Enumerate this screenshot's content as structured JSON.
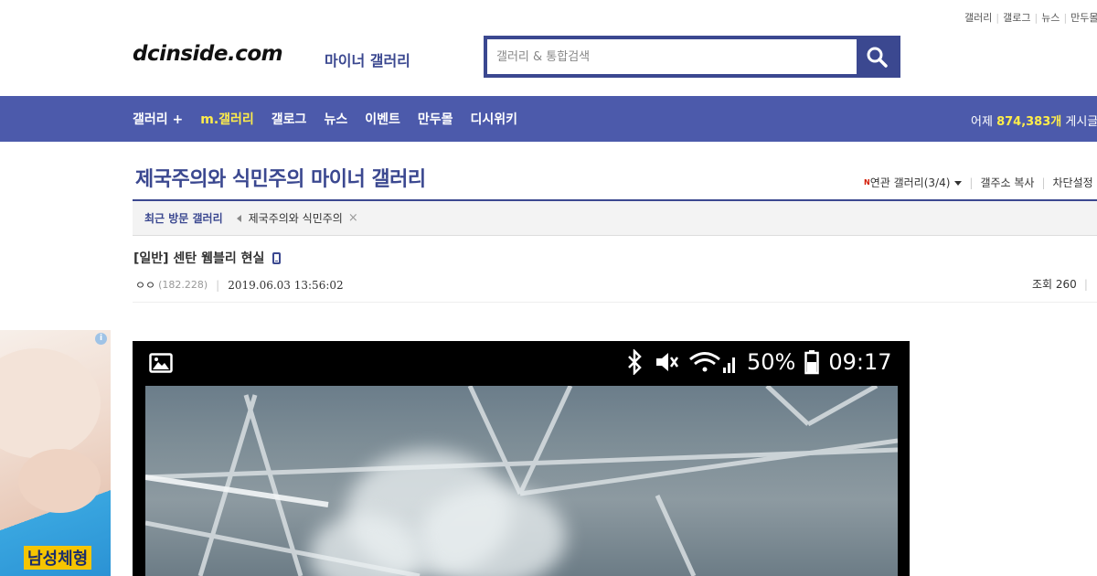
{
  "top_links": [
    "갤러리",
    "갤로그",
    "뉴스",
    "만두몰"
  ],
  "header": {
    "logo": "dcinside.com",
    "logo_sub": "마이너 갤러리",
    "search_placeholder": "갤러리 & 통합검색",
    "search_icon": "search-icon"
  },
  "nav": {
    "items": [
      {
        "label": "갤러리 +",
        "active": false
      },
      {
        "label": "m.갤러리",
        "active": true
      },
      {
        "label": "갤로그",
        "active": false
      },
      {
        "label": "뉴스",
        "active": false
      },
      {
        "label": "이벤트",
        "active": false
      },
      {
        "label": "만두몰",
        "active": false
      },
      {
        "label": "디시위키",
        "active": false
      }
    ],
    "stat_prefix": "어제 ",
    "stat_value": "874,383개",
    "stat_suffix": " 게시글"
  },
  "gallery": {
    "title": "제국주의와 식민주의 마이너 갤러리",
    "related_new_badge": "N",
    "related": "연관 갤러리(3/4)",
    "copy": "갤주소 복사",
    "block": "차단설정"
  },
  "recent": {
    "label": "최근 방문 갤러리",
    "items": [
      "제국주의와 식민주의"
    ],
    "close": "×"
  },
  "post": {
    "title": "[일반] 센탄 웸블리 현실",
    "author": "ㅇㅇ",
    "ip": "(182.228)",
    "date": "2019.06.03 13:56:02",
    "views_label": "조회 260"
  },
  "ad": {
    "info": "i",
    "text": "남성체형"
  },
  "image": {
    "battery_percent": "50%",
    "time": "09:17"
  },
  "colors": {
    "brand": "#3b4890",
    "nav_bg": "#4c5aab",
    "nav_active": "#ffed4a"
  }
}
